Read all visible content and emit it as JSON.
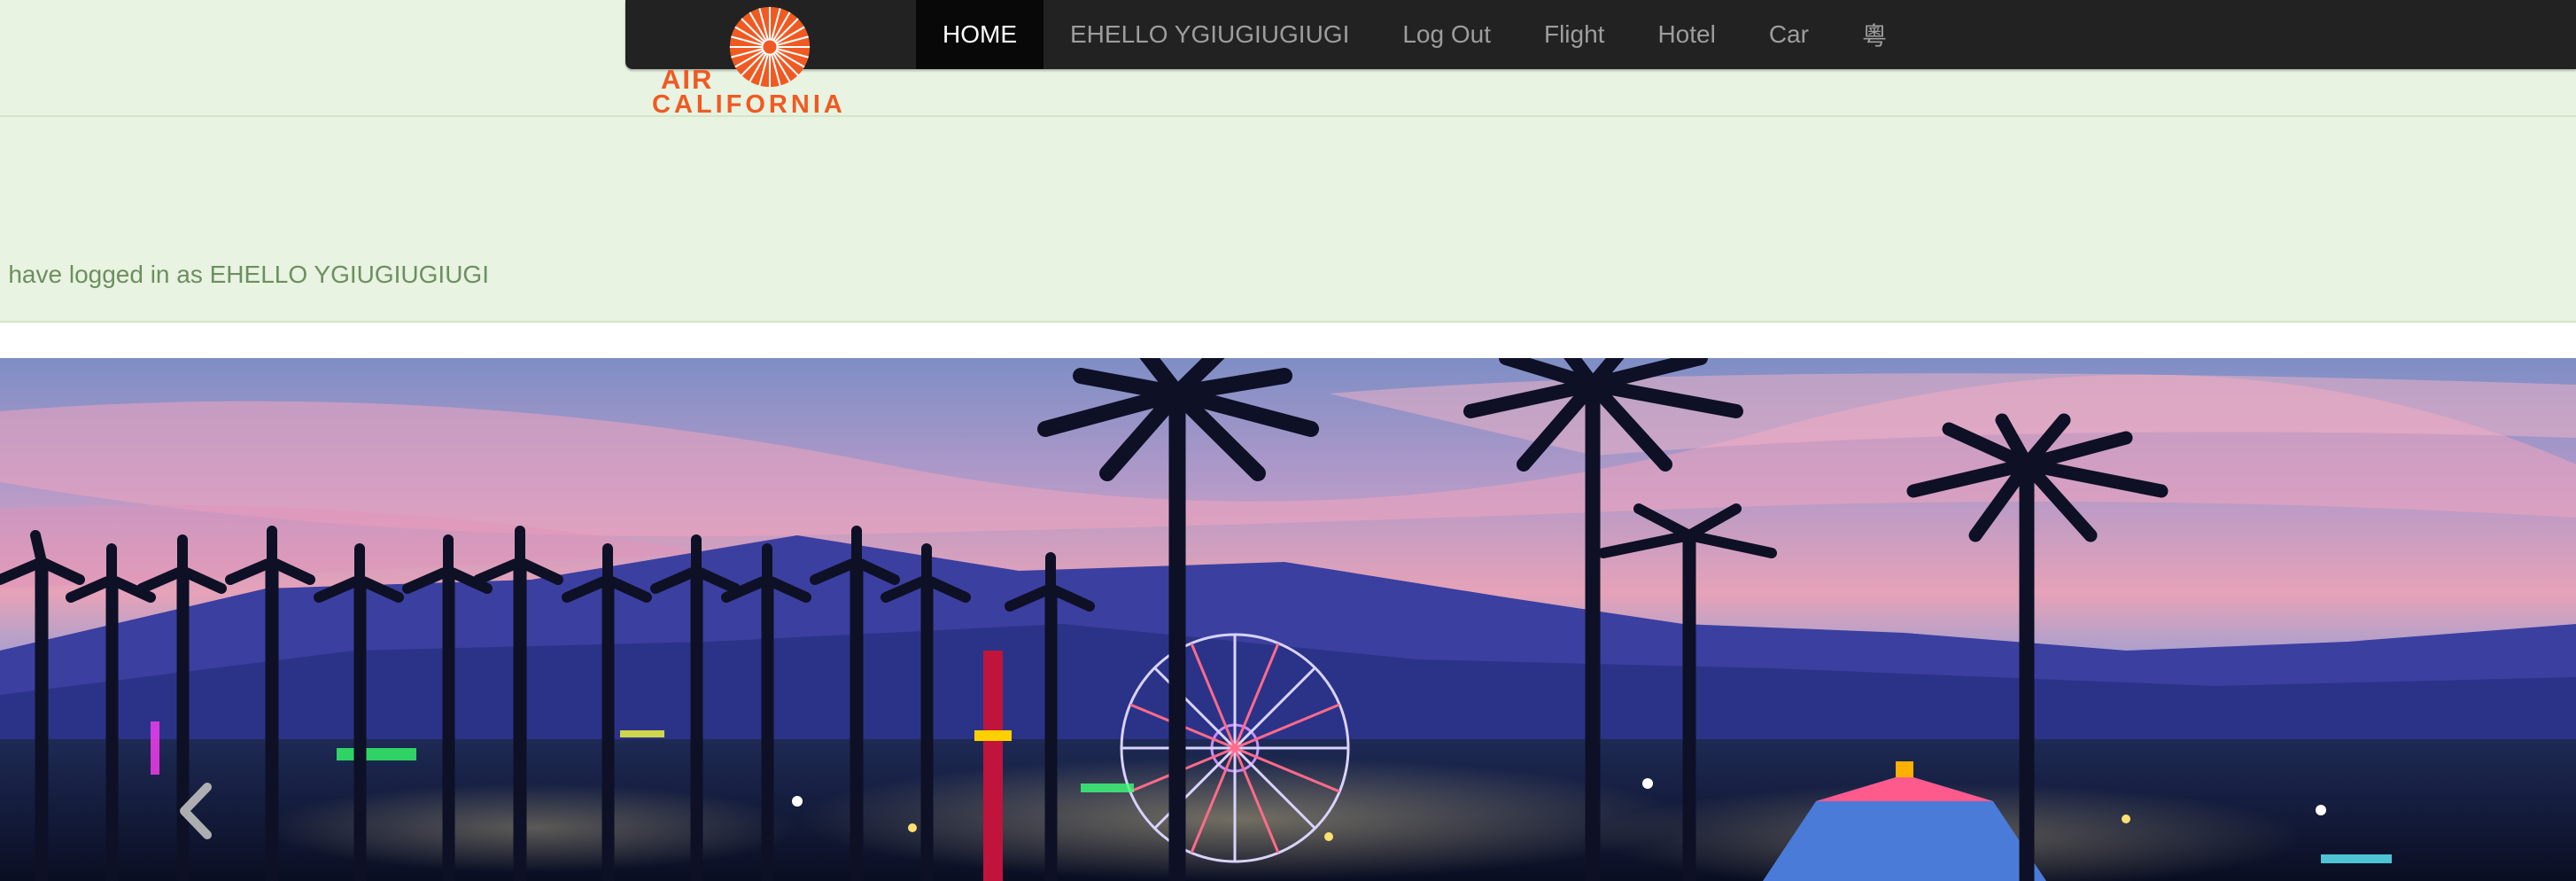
{
  "brand": {
    "logo_line1": "AIR",
    "logo_line2": "CALIFORNIA",
    "color": "#f05a22"
  },
  "nav": {
    "items": [
      {
        "label": "HOME",
        "active": true
      },
      {
        "label": "EHELLO YGIUGIUGIUGI",
        "active": false
      },
      {
        "label": "Log Out",
        "active": false
      },
      {
        "label": "Flight",
        "active": false
      },
      {
        "label": "Hotel",
        "active": false
      },
      {
        "label": "Car",
        "active": false
      },
      {
        "label": "粵",
        "active": false
      }
    ]
  },
  "alert": {
    "message": "u have logged in as EHELLO YGIUGIUGIUGI"
  },
  "carousel": {
    "prev_icon": "chevron-left-icon"
  },
  "colors": {
    "navbar_bg": "#222222",
    "nav_active_bg": "#080808",
    "success_bg": "#e8f3e1",
    "success_text": "#6d8f5f"
  }
}
